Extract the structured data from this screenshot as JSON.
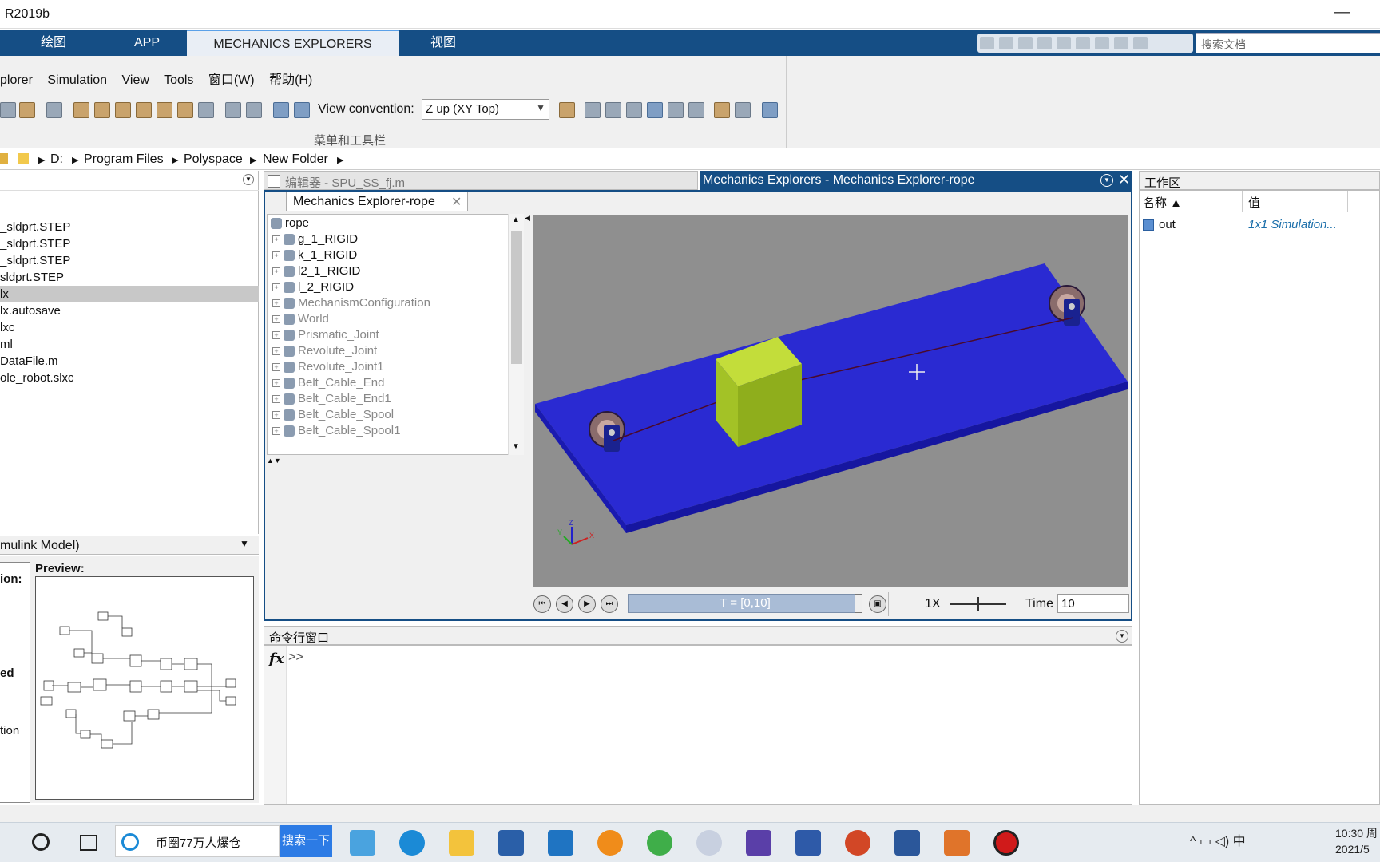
{
  "window": {
    "title": "R2019b",
    "minimize": "—"
  },
  "ribbon": {
    "tabs": [
      "绘图",
      "APP",
      "MECHANICS EXPLORERS",
      "视图"
    ],
    "search_placeholder": "搜索文档"
  },
  "menu": {
    "items": [
      "plorer",
      "Simulation",
      "View",
      "Tools",
      "窗口(W)",
      "帮助(H)"
    ]
  },
  "toolbar": {
    "view_convention_label": "View convention:",
    "view_convention_value": "Z up (XY Top)",
    "group_label": "菜单和工具栏"
  },
  "address": {
    "segments": [
      "D:",
      "Program Files",
      "Polyspace",
      "New Folder"
    ]
  },
  "files": {
    "items": [
      "_sldprt.STEP",
      "_sldprt.STEP",
      "_sldprt.STEP",
      "sldprt.STEP",
      "lx",
      "lx.autosave",
      "lxc",
      "ml",
      "DataFile.m",
      "ole_robot.slxc"
    ],
    "selected_index": 4
  },
  "details": {
    "header": "mulink Model)",
    "preview_label": "Preview:",
    "side_labels": [
      "ion:",
      "ed",
      "tion"
    ]
  },
  "editor": {
    "tab": "编辑器 - SPU_SS_fj.m"
  },
  "mechanics": {
    "title": "Mechanics Explorers - Mechanics Explorer-rope",
    "doc_tab": "Mechanics Explorer-rope",
    "tree": [
      {
        "label": "rope",
        "dim": false
      },
      {
        "label": "g_1_RIGID",
        "dim": false
      },
      {
        "label": "k_1_RIGID",
        "dim": false
      },
      {
        "label": "l2_1_RIGID",
        "dim": false
      },
      {
        "label": "l_2_RIGID",
        "dim": false
      },
      {
        "label": "MechanismConfiguration",
        "dim": true
      },
      {
        "label": "World",
        "dim": true
      },
      {
        "label": "Prismatic_Joint",
        "dim": true
      },
      {
        "label": "Revolute_Joint",
        "dim": true
      },
      {
        "label": "Revolute_Joint1",
        "dim": true
      },
      {
        "label": "Belt_Cable_End",
        "dim": true
      },
      {
        "label": "Belt_Cable_End1",
        "dim": true
      },
      {
        "label": "Belt_Cable_Spool",
        "dim": true
      },
      {
        "label": "Belt_Cable_Spool1",
        "dim": true
      }
    ],
    "axes": {
      "z": "Z",
      "y": "Y",
      "x": "X"
    },
    "playback": {
      "range": "T = [0,10]",
      "speed": "1X",
      "time_label": "Time",
      "time_value": "10"
    }
  },
  "command": {
    "header": "命令行窗口",
    "prompt": ">>",
    "fx": "fx"
  },
  "workspace": {
    "header": "工作区",
    "col_name": "名称 ▲",
    "col_value": "值",
    "rows": [
      {
        "name": "out",
        "value": "1x1 Simulation..."
      }
    ]
  },
  "taskbar": {
    "search_text": "币圈77万人爆仓",
    "search_button": "搜索一下",
    "tray": "^  ▭  ◁)  中",
    "time": "10:30 周",
    "date": "2021/5"
  },
  "colors": {
    "ribbon": "#154e85",
    "plate": "#2a2ad2",
    "block": "#9fbd1e",
    "viewport": "#8f8f8f"
  }
}
